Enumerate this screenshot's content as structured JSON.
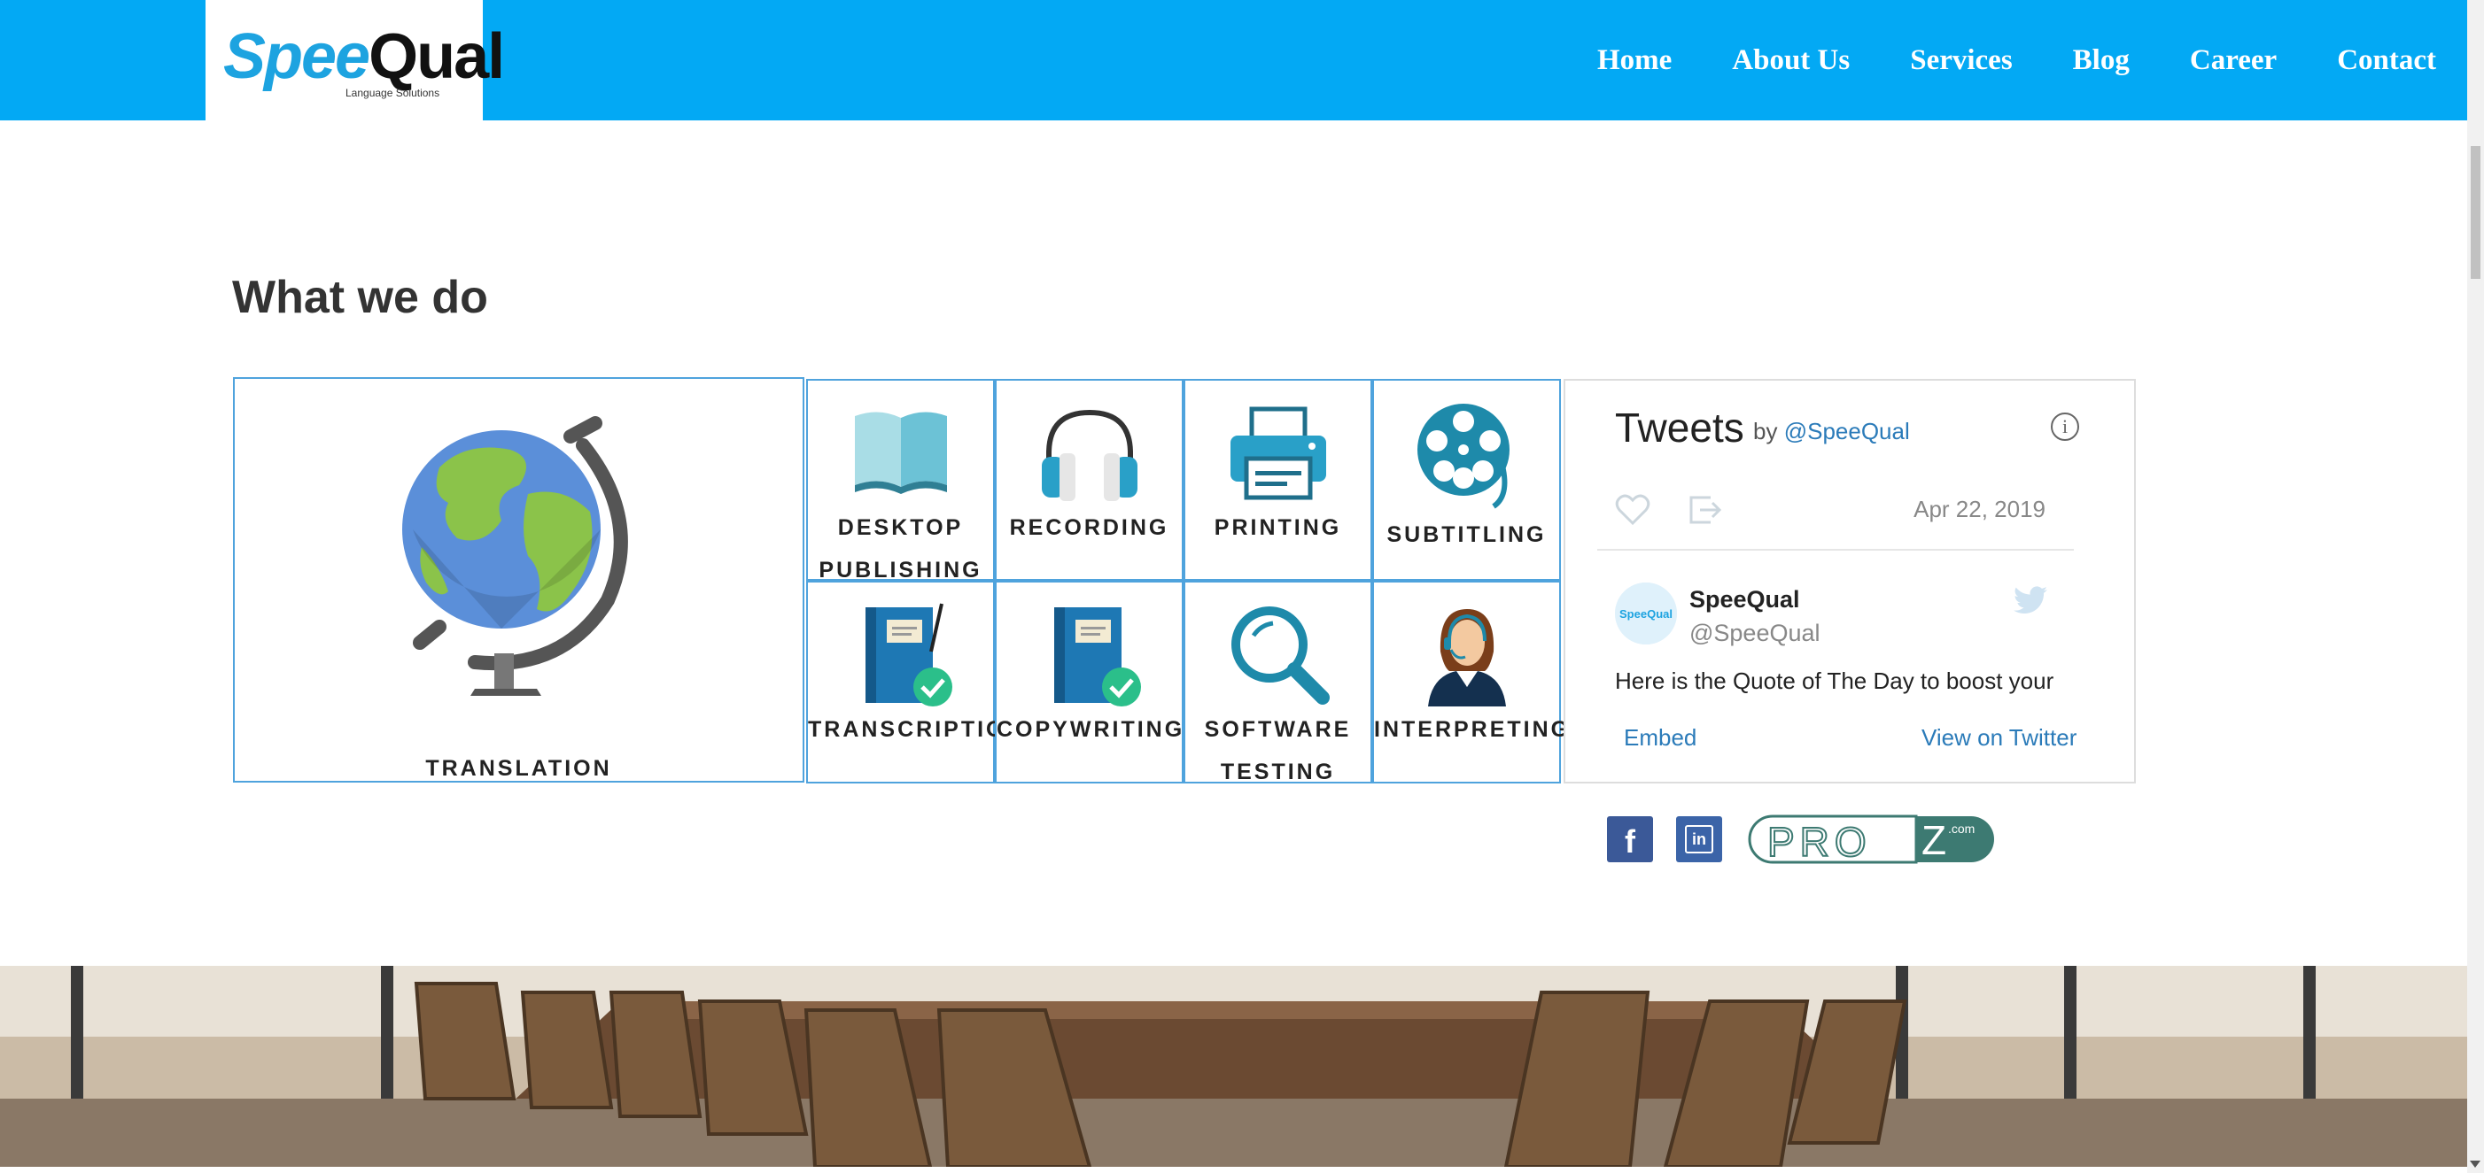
{
  "header": {
    "logo": {
      "text_left": "Spee",
      "text_right": "Qual",
      "tagline": "Language Solutions"
    },
    "menu": [
      {
        "label": "Home"
      },
      {
        "label": "About Us"
      },
      {
        "label": "Services"
      },
      {
        "label": "Blog"
      },
      {
        "label": "Career"
      },
      {
        "label": "Contact"
      }
    ]
  },
  "section": {
    "title": "What we do"
  },
  "services": {
    "translation": {
      "label": "TRANSLATION",
      "icon": "globe-icon"
    },
    "grid": [
      {
        "line1": "DESKTOP",
        "line2": "PUBLISHING",
        "icon": "book-icon"
      },
      {
        "line1": "RECORDING",
        "line2": "",
        "icon": "headphones-icon"
      },
      {
        "line1": "PRINTING",
        "line2": "",
        "icon": "printer-icon"
      },
      {
        "line1": "SUBTITLING",
        "line2": "",
        "icon": "film-reel-icon"
      },
      {
        "line1": "TRANSCRIPTION",
        "line2": "",
        "icon": "notebook-check-icon"
      },
      {
        "line1": "COPYWRITING",
        "line2": "",
        "icon": "notebook-check-icon"
      },
      {
        "line1": "SOFTWARE",
        "line2": "TESTING",
        "icon": "magnifier-icon"
      },
      {
        "line1": "INTERPRETING",
        "line2": "",
        "icon": "interpreter-icon"
      }
    ]
  },
  "twitter": {
    "title": "Tweets",
    "by": "by",
    "handle": "@SpeeQual",
    "date": "Apr 22, 2019",
    "author_name": "SpeeQual",
    "author_handle": "@SpeeQual",
    "tweet_text": "Here is the Quote of The Day to boost your",
    "embed": "Embed",
    "view": "View on Twitter"
  },
  "social": {
    "facebook": "f",
    "linkedin": "in",
    "proz_left": "PRO",
    "proz_right": "Z",
    "proz_com": ".com"
  },
  "colors": {
    "brand_blue": "#03a9f4",
    "card_border": "#4fa3dd",
    "link": "#2b7bb9"
  }
}
